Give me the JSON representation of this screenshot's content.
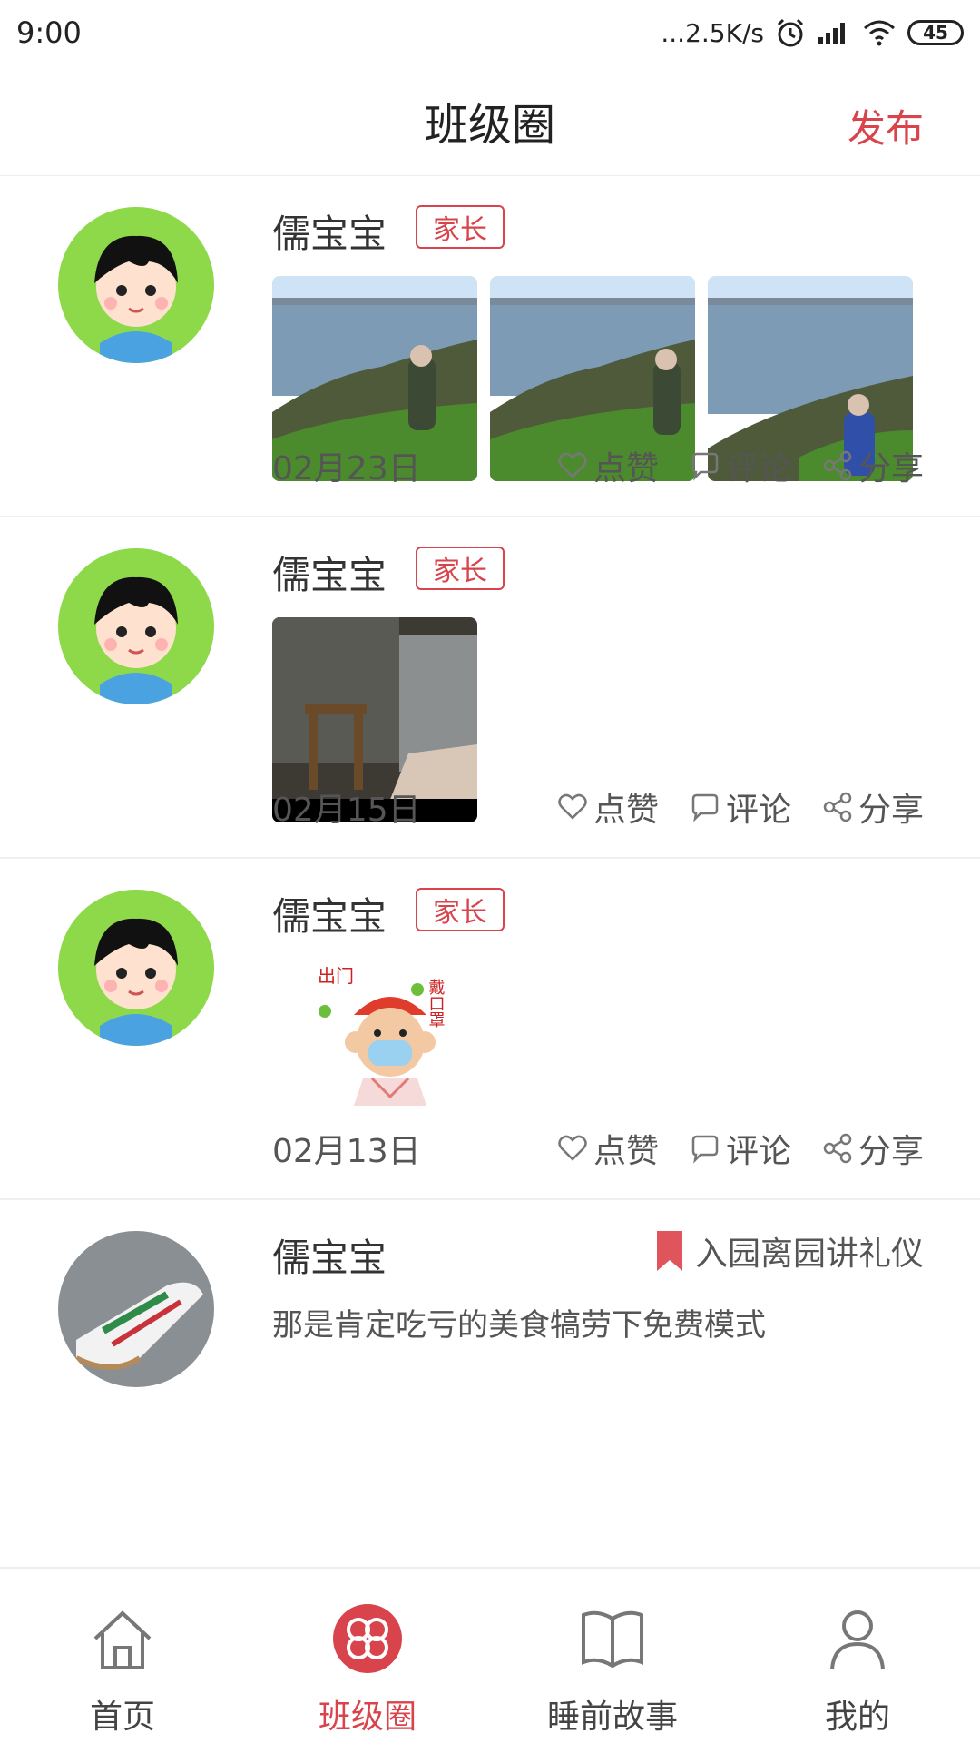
{
  "status_bar": {
    "time": "9:00",
    "net_speed": "...2.5K/s",
    "battery": "45"
  },
  "header": {
    "title": "班级圈",
    "publish_label": "发布"
  },
  "colors": {
    "accent": "#d9434b",
    "avatar_bg": "#8ed94a"
  },
  "posts": [
    {
      "user": "儒宝宝",
      "role": "家长",
      "date": "02月23日",
      "like": "点赞",
      "comment": "评论",
      "share": "分享"
    },
    {
      "user": "儒宝宝",
      "role": "家长",
      "date": "02月15日",
      "like": "点赞",
      "comment": "评论",
      "share": "分享"
    },
    {
      "user": "儒宝宝",
      "role": "家长",
      "date": "02月13日",
      "like": "点赞",
      "comment": "评论",
      "share": "分享"
    },
    {
      "user": "儒宝宝",
      "tag": "入园离园讲礼仪",
      "excerpt": "那是肯定吃亏的美食犒劳下免费模式"
    }
  ],
  "sticker": {
    "text_left": "出门",
    "text_right": "戴口罩"
  },
  "nav": [
    {
      "label": "首页",
      "icon": "home-icon"
    },
    {
      "label": "班级圈",
      "icon": "clover-icon"
    },
    {
      "label": "睡前故事",
      "icon": "book-icon"
    },
    {
      "label": "我的",
      "icon": "user-icon"
    }
  ]
}
